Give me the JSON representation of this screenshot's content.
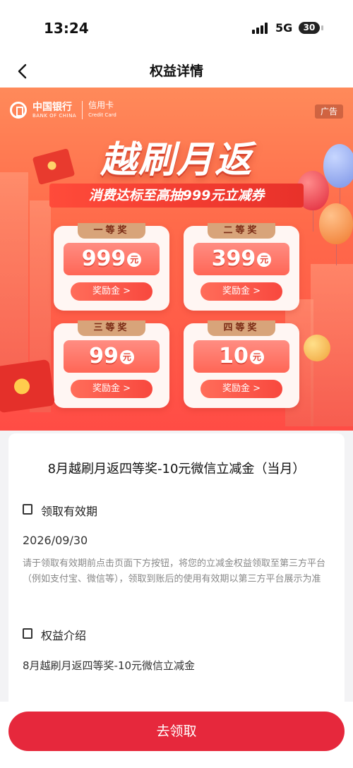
{
  "status_bar": {
    "time": "13:24",
    "network": "5G",
    "battery": "30"
  },
  "header": {
    "title": "权益详情"
  },
  "banner": {
    "bank_name_cn": "中国银行",
    "bank_name_en": "BANK OF CHINA",
    "card_label": "信用卡",
    "card_label_en": "Credit Card",
    "ad_label": "广告",
    "headline": "越刷月返",
    "subheadline": "消费达标至高抽999元立减券",
    "prizes": [
      {
        "tier": "一等奖",
        "amount": "999",
        "unit": "元",
        "button": "奖励金 >"
      },
      {
        "tier": "二等奖",
        "amount": "399",
        "unit": "元",
        "button": "奖励金 >"
      },
      {
        "tier": "三等奖",
        "amount": "99",
        "unit": "元",
        "button": "奖励金 >"
      },
      {
        "tier": "四等奖",
        "amount": "10",
        "unit": "元",
        "button": "奖励金 >"
      }
    ]
  },
  "detail": {
    "title": "8月越刷月返四等奖-10元微信立减金（当月）",
    "validity_label": "领取有效期",
    "validity_date": "2026/09/30",
    "validity_desc": "请于领取有效期前点击页面下方按钮，将您的立减金权益领取至第三方平台（例如支付宝、微信等），领取到账后的使用有效期以第三方平台展示为准",
    "intro_label": "权益介绍",
    "intro_text": "8月越刷月返四等奖-10元微信立减金"
  },
  "cta": {
    "label": "去领取"
  },
  "colors": {
    "brand_red": "#e6283c",
    "banner_orange": "#ff6a4a"
  }
}
